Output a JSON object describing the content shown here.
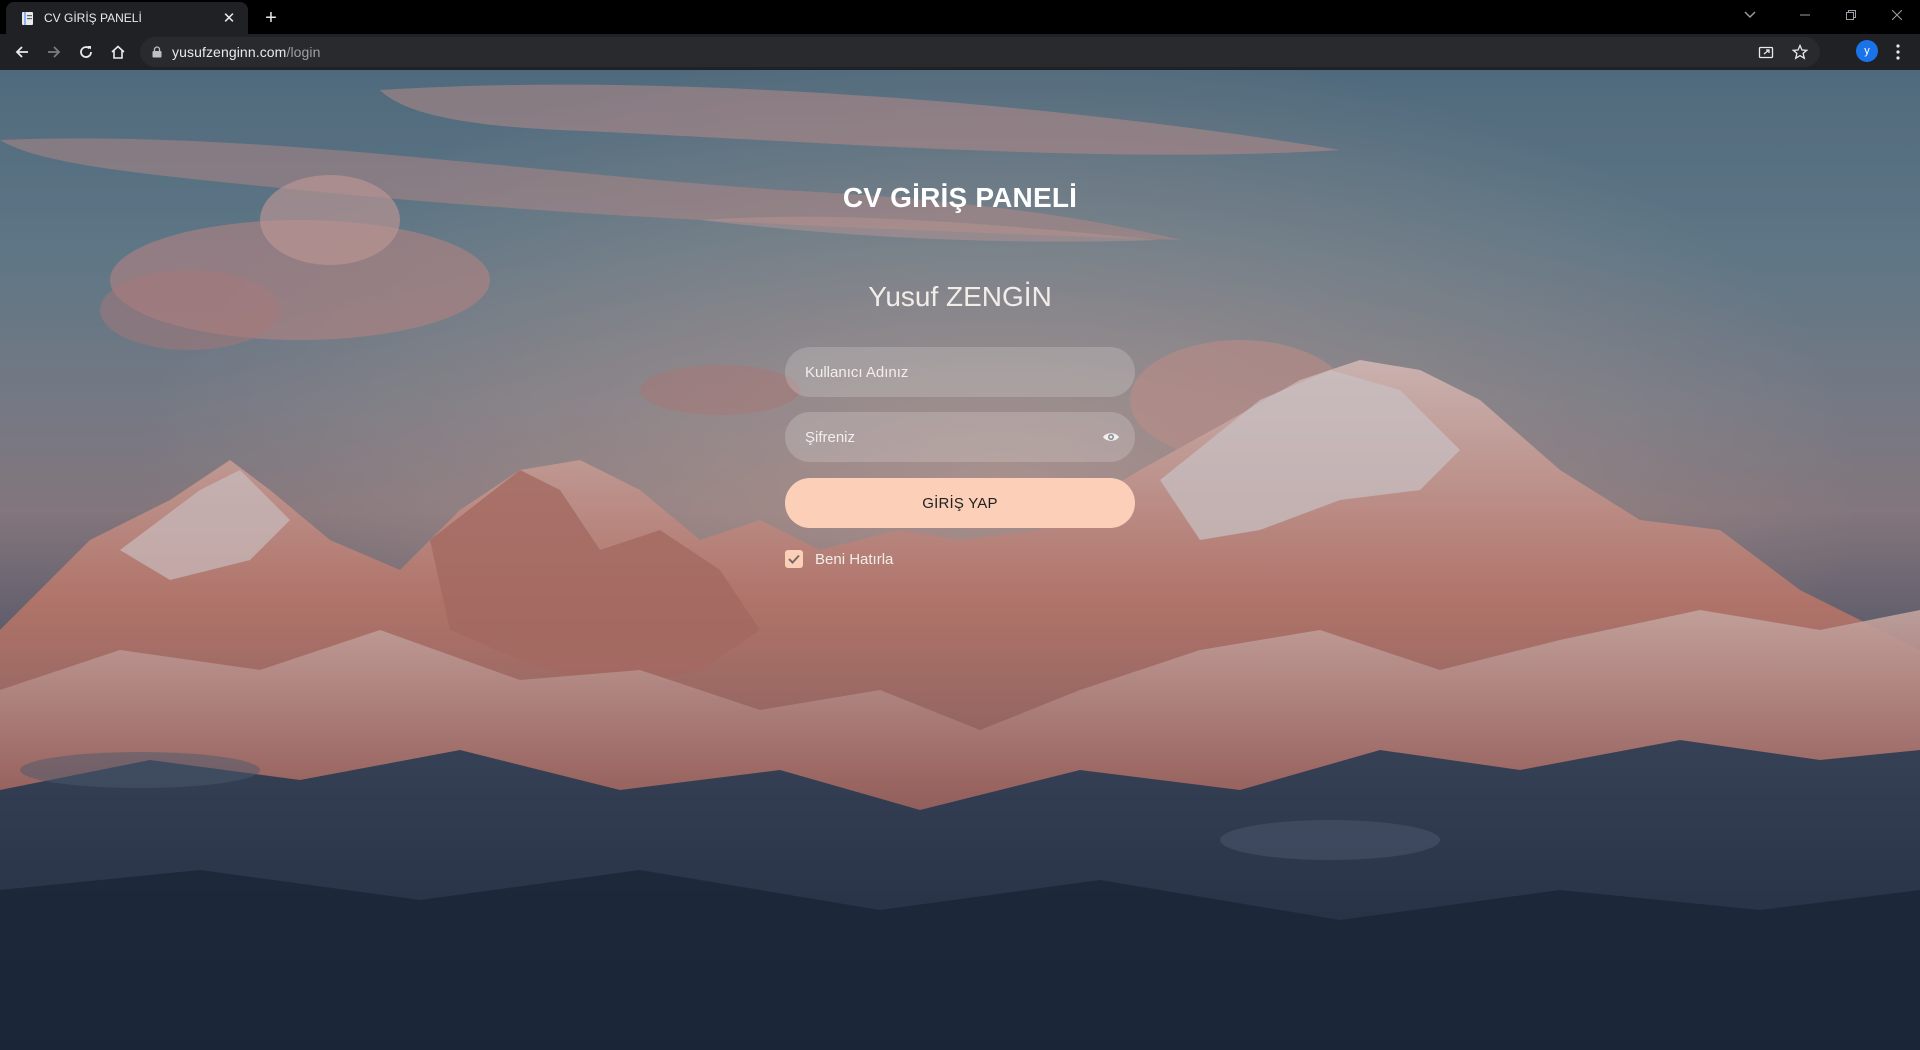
{
  "browser": {
    "tab": {
      "title": "CV GİRİŞ PANELİ",
      "favicon": "document-icon",
      "close": "✕"
    },
    "new_tab": "+",
    "url": {
      "host": "yusufzenginn.com",
      "path": "/login"
    },
    "profile_initial": "y",
    "profile_color": "#1a73e8"
  },
  "page": {
    "title": "CV GİRİŞ PANELİ",
    "owner": "Yusuf ZENGİN",
    "username": {
      "placeholder": "Kullanıcı Adınız",
      "value": ""
    },
    "password": {
      "placeholder": "Şifreniz",
      "value": "",
      "icon": "eye-icon"
    },
    "login_label": "GİRİŞ YAP",
    "remember": {
      "label": "Beni Hatırla",
      "checked": true
    },
    "accent_color": "#fbcfb8"
  }
}
